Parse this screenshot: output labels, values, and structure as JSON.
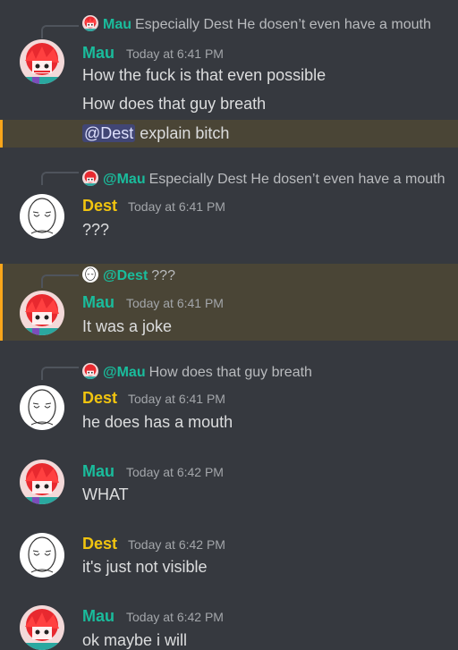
{
  "messages": [
    {
      "author": "Mau",
      "timestamp": "Today at 6:41 PM",
      "reply": {
        "author": "Mau",
        "text": "Especially Dest He dosen’t even have a mouth"
      },
      "lines": [
        "How the fuck is that even possible",
        "How does that guy breath"
      ]
    },
    {
      "highlighted": true,
      "mention": "@Dest",
      "text": " explain bitch"
    },
    {
      "author": "Dest",
      "timestamp": "Today at 6:41 PM",
      "reply": {
        "author": "@Mau",
        "text": "Especially Dest He dosen’t even have a mouth"
      },
      "lines": [
        "???"
      ]
    },
    {
      "author": "Mau",
      "timestamp": "Today at 6:41 PM",
      "highlighted": true,
      "reply": {
        "author": "@Dest",
        "text": "???"
      },
      "lines": [
        "It was a joke"
      ]
    },
    {
      "author": "Dest",
      "timestamp": "Today at 6:41 PM",
      "reply": {
        "author": "@Mau",
        "text": "How does that guy breath"
      },
      "lines": [
        "he does has a mouth"
      ]
    },
    {
      "author": "Mau",
      "timestamp": "Today at 6:42 PM",
      "lines": [
        "WHAT"
      ]
    },
    {
      "author": "Dest",
      "timestamp": "Today at 6:42 PM",
      "lines": [
        "it's just not visible"
      ]
    },
    {
      "author": "Mau",
      "timestamp": "Today at 6:42 PM",
      "lines": [
        "ok maybe i will"
      ]
    }
  ],
  "icons": {
    "mau_avatar": "red-haired-character-avatar",
    "dest_avatar": "sketched-face-avatar"
  },
  "colors": {
    "background": "#36393f",
    "highlight": "#4a4536",
    "highlight_bar": "#faa61a",
    "mau_name": "#1abc9c",
    "dest_name": "#f1c40f",
    "mention_bg": "#414675"
  }
}
